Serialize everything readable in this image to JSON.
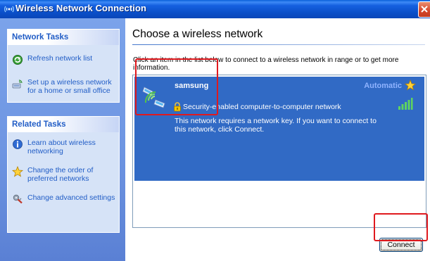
{
  "window": {
    "title": "Wireless Network Connection",
    "title_icon": "wireless-icon",
    "close_icon": "close-icon"
  },
  "left_pane": {
    "network_tasks": {
      "title": "Network Tasks",
      "items": [
        {
          "label": "Refresh network list",
          "icon": "refresh-icon"
        },
        {
          "label": "Set up a wireless network for a home or small office",
          "icon": "setup-wireless-icon"
        }
      ]
    },
    "related_tasks": {
      "title": "Related Tasks",
      "items": [
        {
          "label": "Learn about wireless networking",
          "icon": "info-icon"
        },
        {
          "label": "Change the order of preferred networks",
          "icon": "star-icon"
        },
        {
          "label": "Change advanced settings",
          "icon": "settings-icon"
        }
      ]
    }
  },
  "main": {
    "heading": "Choose a wireless network",
    "instructions": "Click an item in the list below to connect to a wireless network in range or to get more information.",
    "networks": [
      {
        "name": "samsung",
        "mode": "Automatic",
        "security": "Security-enabled computer-to-computer network",
        "description": "This network requires a network key. If you want to connect to this network, click Connect.",
        "signal_strength": 1.0
      }
    ],
    "connect_button": "Connect"
  },
  "colors": {
    "titlebar": "#0a4fc8",
    "left_pane": "#6e95e2",
    "selection": "#316ac5",
    "link": "#215dc6",
    "highlight_box": "#e0191e"
  }
}
